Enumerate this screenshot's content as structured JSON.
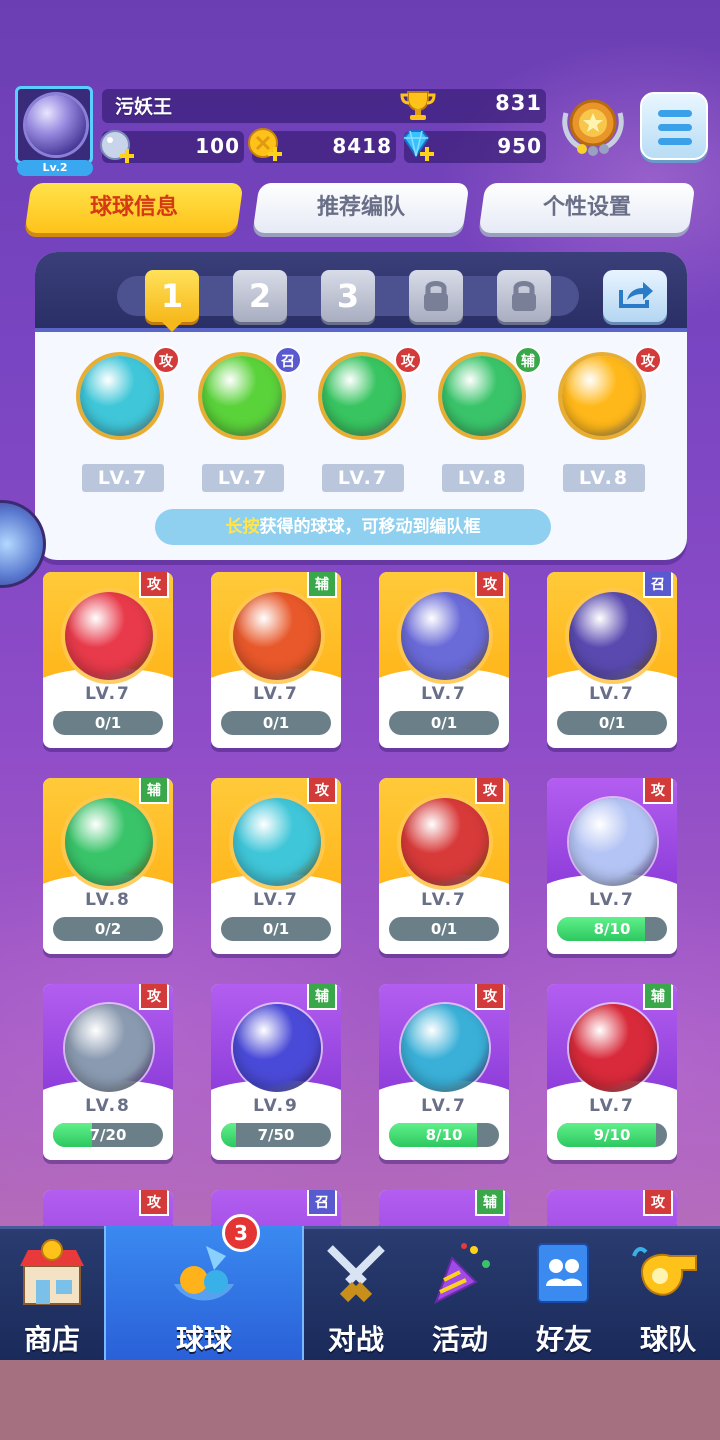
{
  "player": {
    "name": "污妖王",
    "level_label": "Lv.2",
    "trophies": "831",
    "stamina": "100",
    "coins": "8418",
    "diamonds": "950"
  },
  "tabs": [
    {
      "label": "球球信息",
      "active": true
    },
    {
      "label": "推荐编队",
      "active": false
    },
    {
      "label": "个性设置",
      "active": false
    }
  ],
  "team": {
    "slots": [
      {
        "label": "1",
        "state": "active"
      },
      {
        "label": "2",
        "state": "normal"
      },
      {
        "label": "3",
        "state": "normal"
      },
      {
        "label": "",
        "state": "locked"
      },
      {
        "label": "",
        "state": "locked"
      }
    ],
    "balls": [
      {
        "icon": "tornado-ball-icon",
        "tag": "攻",
        "level": "LV.7",
        "color": "#3fc6d8"
      },
      {
        "icon": "radiation-ball-icon",
        "tag": "召",
        "level": "LV.7",
        "color": "#5ad23a"
      },
      {
        "icon": "skull-ball-icon",
        "tag": "攻",
        "level": "LV.7",
        "color": "#38c460"
      },
      {
        "icon": "star-arrow-ball-icon",
        "tag": "辅",
        "level": "LV.8",
        "color": "#3ac46a"
      },
      {
        "icon": "lightning-ball-icon",
        "tag": "攻",
        "level": "LV.8",
        "color": "#ffb81a"
      }
    ],
    "hint_highlight": "长按",
    "hint_text": "获得的球球，可移动到编队框"
  },
  "cards": [
    {
      "icon": "fish-ball-icon",
      "tag": "攻",
      "level": "LV.7",
      "progress": "0/1",
      "fill": 0,
      "style": "gold",
      "color": "#e83a4a"
    },
    {
      "icon": "phoenix-ball-icon",
      "tag": "辅",
      "level": "LV.7",
      "progress": "0/1",
      "fill": 0,
      "style": "gold",
      "color": "#e8582a"
    },
    {
      "icon": "pixel-ball-icon",
      "tag": "攻",
      "level": "LV.7",
      "progress": "0/1",
      "fill": 0,
      "style": "gold",
      "color": "#6a6ad8"
    },
    {
      "icon": "ghost-ball-icon",
      "tag": "召",
      "level": "LV.7",
      "progress": "0/1",
      "fill": 0,
      "style": "gold",
      "color": "#5a4ab0"
    },
    {
      "icon": "star-arrow-ball-icon",
      "tag": "辅",
      "level": "LV.8",
      "progress": "0/2",
      "fill": 0,
      "style": "gold",
      "color": "#3ac46a"
    },
    {
      "icon": "tornado-ball-icon",
      "tag": "攻",
      "level": "LV.7",
      "progress": "0/1",
      "fill": 0,
      "style": "gold",
      "color": "#3fc6d8"
    },
    {
      "icon": "fist-ball-icon",
      "tag": "攻",
      "level": "LV.7",
      "progress": "0/1",
      "fill": 0,
      "style": "gold",
      "color": "#d83a3a"
    },
    {
      "icon": "bubble-ball-icon",
      "tag": "攻",
      "level": "LV.7",
      "progress": "8/10",
      "fill": 0.8,
      "style": "purple",
      "color": "#b4c4f4"
    },
    {
      "icon": "swirl-ball-icon",
      "tag": "攻",
      "level": "LV.8",
      "progress": "7/20",
      "fill": 0.35,
      "style": "purple",
      "color": "#8a9ab0"
    },
    {
      "icon": "swap-arrow-ball-icon",
      "tag": "辅",
      "level": "LV.9",
      "progress": "7/50",
      "fill": 0.14,
      "style": "purple",
      "color": "#4a4ad8"
    },
    {
      "icon": "vortex-ball-icon",
      "tag": "攻",
      "level": "LV.7",
      "progress": "8/10",
      "fill": 0.8,
      "style": "purple",
      "color": "#3ab0d8"
    },
    {
      "icon": "fang-ball-icon",
      "tag": "辅",
      "level": "LV.7",
      "progress": "9/10",
      "fill": 0.9,
      "style": "purple",
      "color": "#d82a3a"
    }
  ],
  "partial_row_tags": [
    "攻",
    "召",
    "辅",
    "攻"
  ],
  "nav": [
    {
      "label": "商店",
      "icon": "shop-icon",
      "active": false
    },
    {
      "label": "球球",
      "icon": "balls-icon",
      "active": true,
      "badge": "3"
    },
    {
      "label": "对战",
      "icon": "crossed-swords-icon",
      "active": false
    },
    {
      "label": "活动",
      "icon": "party-popper-icon",
      "active": false
    },
    {
      "label": "好友",
      "icon": "friends-book-icon",
      "active": false
    },
    {
      "label": "球队",
      "icon": "whistle-icon",
      "active": false
    }
  ],
  "colors": {
    "attack": "#d33a3a",
    "summon": "#5a5ad0",
    "support": "#3aa84a",
    "accent": "#ffc21a"
  }
}
